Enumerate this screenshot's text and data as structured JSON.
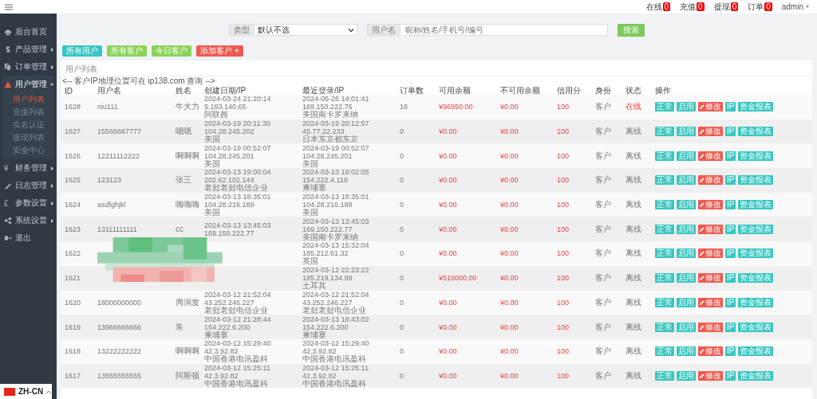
{
  "topbar": {
    "counters": [
      {
        "label": "在线",
        "count": "0"
      },
      {
        "label": "充值",
        "count": "0"
      },
      {
        "label": "提现",
        "count": "0"
      },
      {
        "label": "订单",
        "count": "0"
      }
    ],
    "user": "admin"
  },
  "sidebar": {
    "items": [
      {
        "label": "后台首页",
        "selected": false,
        "has_arrow": false
      },
      {
        "label": "产品管理",
        "selected": false,
        "has_arrow": true
      },
      {
        "label": "订单管理",
        "selected": false,
        "has_arrow": true
      },
      {
        "label": "用户管理",
        "expanded": true,
        "selected": true,
        "has_arrow": true,
        "children": [
          {
            "label": "用户列表",
            "selected": true
          },
          {
            "label": "充值列表",
            "selected": false
          },
          {
            "label": "实名认证",
            "selected": false
          },
          {
            "label": "提现列表",
            "selected": false
          },
          {
            "label": "安全中心",
            "selected": false
          }
        ]
      },
      {
        "label": "财务管理",
        "glyph": "¥",
        "selected": false,
        "has_arrow": true
      },
      {
        "label": "日志管理",
        "selected": false,
        "has_arrow": true
      },
      {
        "label": "参数设置",
        "glyph": "£",
        "selected": false,
        "has_arrow": true
      },
      {
        "label": "系统设置",
        "selected": false,
        "has_arrow": true
      },
      {
        "label": "退出",
        "selected": false,
        "has_arrow": false
      }
    ]
  },
  "search": {
    "type_label": "类型",
    "type_value": "默认不选",
    "name_label": "用户名",
    "name_placeholder": "昵称/姓名/手机号/编号",
    "button": "搜索"
  },
  "filter_buttons": [
    {
      "label": "所有用户",
      "kind": "teal"
    },
    {
      "label": "所有客户",
      "kind": "green"
    },
    {
      "label": "今日客户",
      "kind": "green"
    },
    {
      "label": "添加客户 +",
      "kind": "danger"
    }
  ],
  "panel": {
    "title": "用户列表",
    "comment": "<-- 客户IP地理位置可在 ip138.com 查询 -->"
  },
  "table": {
    "columns": [
      "ID",
      "用户名",
      "姓名",
      "创建日期/IP",
      "最近登录/IP",
      "订单数",
      "可用余额",
      "不可用余额",
      "信用分",
      "身份",
      "状态",
      "操作"
    ],
    "rows": [
      {
        "id": "1628",
        "username": "niu111",
        "name": "牛大力",
        "created": [
          "2024-03-24 21:20:14",
          "5.193.140.65",
          "阿联酋"
        ],
        "login": [
          "2024-05-26 14:01:41",
          "169.150.222.76",
          "美国南卡罗来纳"
        ],
        "orders": "16",
        "available": "¥96950.00",
        "frozen": "¥0.00",
        "credit": "100",
        "role": "客户",
        "status": "在线",
        "online": true,
        "actions": [
          {
            "label": "正常",
            "kind": "teal"
          },
          {
            "label": "启用",
            "kind": "teal"
          },
          {
            "label": "修改",
            "kind": "edit"
          },
          {
            "label": "IP",
            "kind": "teal"
          },
          {
            "label": "资金报表",
            "kind": "teal"
          }
        ]
      },
      {
        "id": "1627",
        "username": "15566667777",
        "name": "嗯嗯",
        "created": [
          "2024-03-19 20:11:30",
          "104.28.245.202",
          "美国"
        ],
        "login": [
          "2024-03-19 20:12:57",
          "45.77.22.233",
          "日本东京都东京"
        ],
        "orders": "0",
        "available": "¥0.00",
        "frozen": "¥0.00",
        "credit": "100",
        "role": "客户",
        "status": "离线",
        "online": false,
        "actions": [
          {
            "label": "正常",
            "kind": "teal"
          },
          {
            "label": "启用",
            "kind": "teal"
          },
          {
            "label": "修改",
            "kind": "edit"
          },
          {
            "label": "IP",
            "kind": "teal"
          },
          {
            "label": "资金报表",
            "kind": "teal"
          }
        ]
      },
      {
        "id": "1626",
        "username": "12211112222",
        "name": "啊啊啊",
        "created": [
          "2024-03-19 00:52:07",
          "104.28.245.201",
          "美国"
        ],
        "login": [
          "2024-03-19 00:52:07",
          "104.28.245.201",
          "美国"
        ],
        "orders": "0",
        "available": "¥0.00",
        "frozen": "¥0.00",
        "credit": "100",
        "role": "客户",
        "status": "离线",
        "online": false,
        "actions": [
          {
            "label": "正常",
            "kind": "teal"
          },
          {
            "label": "启用",
            "kind": "teal"
          },
          {
            "label": "修改",
            "kind": "edit"
          },
          {
            "label": "IP",
            "kind": "teal"
          },
          {
            "label": "资金报表",
            "kind": "teal"
          }
        ]
      },
      {
        "id": "1625",
        "username": "123123",
        "name": "张三",
        "created": [
          "2024-03-13 19:00:04",
          "202.62.102.144",
          "老挝老挝电信企业"
        ],
        "login": [
          "2024-03-13 19:02:05",
          "154.222.4.116",
          "柬埔寨"
        ],
        "orders": "0",
        "available": "¥0.00",
        "frozen": "¥0.00",
        "credit": "100",
        "role": "客户",
        "status": "离线",
        "online": false,
        "actions": [
          {
            "label": "正常",
            "kind": "teal"
          },
          {
            "label": "启用",
            "kind": "teal"
          },
          {
            "label": "修改",
            "kind": "edit"
          },
          {
            "label": "IP",
            "kind": "teal"
          },
          {
            "label": "资金报表",
            "kind": "teal"
          }
        ]
      },
      {
        "id": "1624",
        "username": "asdfghjkl",
        "name": "嗨嗨嗨",
        "created": [
          "2024-03-13 18:35:01",
          "104.28.216.189",
          "美国"
        ],
        "login": [
          "2024-03-13 18:35:01",
          "104.28.216.189",
          "美国"
        ],
        "orders": "0",
        "available": "¥0.00",
        "frozen": "¥0.00",
        "credit": "100",
        "role": "客户",
        "status": "离线",
        "online": false,
        "actions": [
          {
            "label": "正常",
            "kind": "teal"
          },
          {
            "label": "启用",
            "kind": "teal"
          },
          {
            "label": "修改",
            "kind": "edit"
          },
          {
            "label": "IP",
            "kind": "teal"
          },
          {
            "label": "资金报表",
            "kind": "teal"
          }
        ]
      },
      {
        "id": "1623",
        "username": "13111111111",
        "name": "cc",
        "created": [
          "2024-03-13 13:45:03",
          "169.150.222.77"
        ],
        "login": [
          "2024-03-13 13:45:03",
          "169.150.222.77",
          "美国南卡罗来纳"
        ],
        "orders": "0",
        "available": "¥0.00",
        "frozen": "¥0.00",
        "credit": "100",
        "role": "客户",
        "status": "离线",
        "online": false,
        "actions": [
          {
            "label": "正常",
            "kind": "teal"
          },
          {
            "label": "启用",
            "kind": "teal"
          },
          {
            "label": "修改",
            "kind": "edit"
          },
          {
            "label": "IP",
            "kind": "teal"
          },
          {
            "label": "资金报表",
            "kind": "teal"
          }
        ]
      },
      {
        "id": "1622",
        "login": [
          "2024-03-13 15:32:04",
          "185.212.61.32",
          "英国"
        ],
        "orders": "0",
        "available": "¥0.00",
        "frozen": "¥0.00",
        "credit": "100",
        "role": "客户",
        "status": "离线",
        "online": false,
        "actions": [
          {
            "label": "正常",
            "kind": "teal"
          },
          {
            "label": "启用",
            "kind": "teal"
          },
          {
            "label": "修改",
            "kind": "edit"
          },
          {
            "label": "IP",
            "kind": "teal"
          },
          {
            "label": "资金报表",
            "kind": "teal"
          }
        ]
      },
      {
        "id": "1621",
        "login": [
          "2024-03-12 22:23:22",
          "185.219.134.99",
          "土耳其"
        ],
        "orders": "0",
        "available": "¥510000.00",
        "frozen": "¥0.00",
        "credit": "100",
        "role": "客户",
        "status": "离线",
        "online": false,
        "actions": [
          {
            "label": "正常",
            "kind": "teal"
          },
          {
            "label": "启用",
            "kind": "teal"
          },
          {
            "label": "修改",
            "kind": "edit"
          },
          {
            "label": "IP",
            "kind": "teal"
          },
          {
            "label": "资金报表",
            "kind": "teal"
          }
        ]
      },
      {
        "id": "1620",
        "username": "18000000000",
        "name": "周润发",
        "created": [
          "2024-03-12 21:52:04",
          "43.252.246.227",
          "老挝老挝电信企业"
        ],
        "login": [
          "2024-03-12 21:52:04",
          "43.252.246.227",
          "老挝老挝电信企业"
        ],
        "orders": "0",
        "available": "¥0.00",
        "frozen": "¥0.00",
        "credit": "100",
        "role": "客户",
        "status": "离线",
        "online": false,
        "actions": [
          {
            "label": "正常",
            "kind": "teal"
          },
          {
            "label": "启用",
            "kind": "teal"
          },
          {
            "label": "修改",
            "kind": "edit"
          },
          {
            "label": "IP",
            "kind": "teal"
          },
          {
            "label": "资金报表",
            "kind": "teal"
          }
        ]
      },
      {
        "id": "1619",
        "username": "13966666666",
        "name": "朱",
        "created": [
          "2024-03-12 21:28:44",
          "154.222.6.200",
          "柬埔寨"
        ],
        "login": [
          "2024-03-13 18:43:02",
          "154.222.6.200",
          "柬埔寨"
        ],
        "orders": "0",
        "available": "¥0.00",
        "frozen": "¥0.00",
        "credit": "100",
        "role": "客户",
        "status": "离线",
        "online": false,
        "actions": [
          {
            "label": "正常",
            "kind": "teal"
          },
          {
            "label": "启用",
            "kind": "teal"
          },
          {
            "label": "修改",
            "kind": "edit"
          },
          {
            "label": "IP",
            "kind": "teal"
          },
          {
            "label": "资金报表",
            "kind": "teal"
          }
        ]
      },
      {
        "id": "1618",
        "username": "13222222222",
        "name": "啊啊啊",
        "created": [
          "2024-03-12 15:29:40",
          "42.3.92.82",
          "中国香港电讯盈科"
        ],
        "login": [
          "2024-03-12 15:29:40",
          "42.3.92.82",
          "中国香港电讯盈科"
        ],
        "orders": "0",
        "available": "¥0.00",
        "frozen": "¥0.00",
        "credit": "100",
        "role": "客户",
        "status": "离线",
        "online": false,
        "actions": [
          {
            "label": "正常",
            "kind": "teal"
          },
          {
            "label": "启用",
            "kind": "teal"
          },
          {
            "label": "修改",
            "kind": "edit"
          },
          {
            "label": "IP",
            "kind": "teal"
          },
          {
            "label": "资金报表",
            "kind": "teal"
          }
        ]
      },
      {
        "id": "1617",
        "username": "13555555555",
        "name": "阿斯顿",
        "created": [
          "2024-03-12 15:25:11",
          "42.3.92.82",
          "中国香港电讯盈科"
        ],
        "login": [
          "2024-03-12 15:25:11",
          "42.3.92.82",
          "中国香港电讯盈科"
        ],
        "orders": "0",
        "available": "¥0.00",
        "frozen": "¥0.00",
        "credit": "100",
        "role": "客户",
        "status": "离线",
        "online": false,
        "actions": [
          {
            "label": "正常",
            "kind": "teal"
          },
          {
            "label": "启用",
            "kind": "teal"
          },
          {
            "label": "修改",
            "kind": "edit"
          },
          {
            "label": "IP",
            "kind": "teal"
          },
          {
            "label": "资金报表",
            "kind": "teal"
          }
        ]
      }
    ]
  },
  "language": {
    "label": "ZH-CN"
  }
}
